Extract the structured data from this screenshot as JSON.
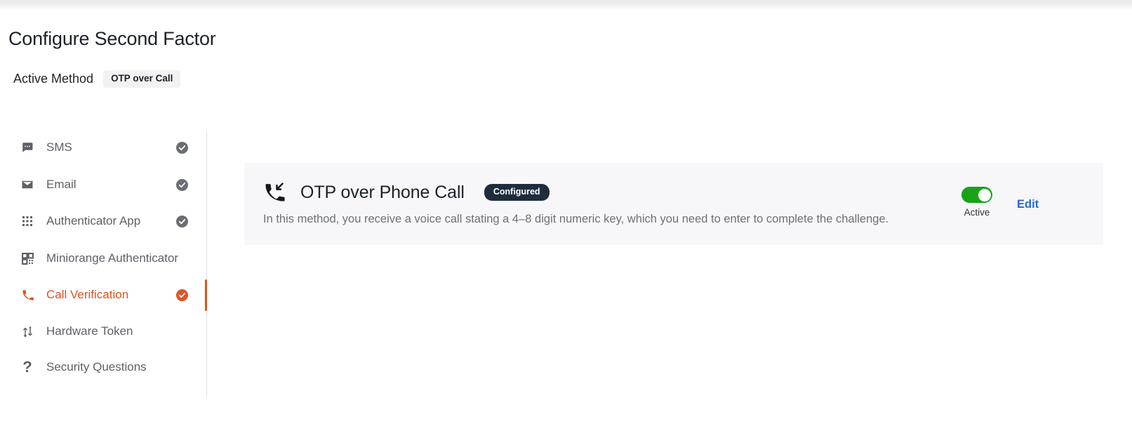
{
  "page": {
    "title": "Configure Second Factor"
  },
  "active_method": {
    "label": "Active Method",
    "value": "OTP over Call"
  },
  "sidebar": {
    "items": [
      {
        "label": "SMS",
        "icon": "chat-bubble-icon",
        "configured": true,
        "active": false
      },
      {
        "label": "Email",
        "icon": "envelope-icon",
        "configured": true,
        "active": false
      },
      {
        "label": "Authenticator App",
        "icon": "dot-grid-icon",
        "configured": true,
        "active": false
      },
      {
        "label": "Miniorange Authenticator",
        "icon": "qr-code-icon",
        "configured": false,
        "active": false
      },
      {
        "label": "Call Verification",
        "icon": "phone-icon",
        "configured": true,
        "active": true
      },
      {
        "label": "Hardware Token",
        "icon": "usb-token-icon",
        "configured": false,
        "active": false
      },
      {
        "label": "Security Questions",
        "icon": "question-mark-icon",
        "configured": false,
        "active": false
      }
    ]
  },
  "method_card": {
    "icon": "incoming-call-icon",
    "title": "OTP over Phone Call",
    "status_badge": "Configured",
    "description": "In this method, you receive a voice call stating a 4–8 digit numeric key, which you need to enter to complete the challenge.",
    "toggle_state_label": "Active",
    "toggle_on": true,
    "edit_label": "Edit"
  },
  "colors": {
    "accent_orange": "#dd5426",
    "toggle_green": "#17a317",
    "badge_navy": "#1f2c3d",
    "link_blue": "#2869cf",
    "card_bg": "#f7f7f9"
  }
}
